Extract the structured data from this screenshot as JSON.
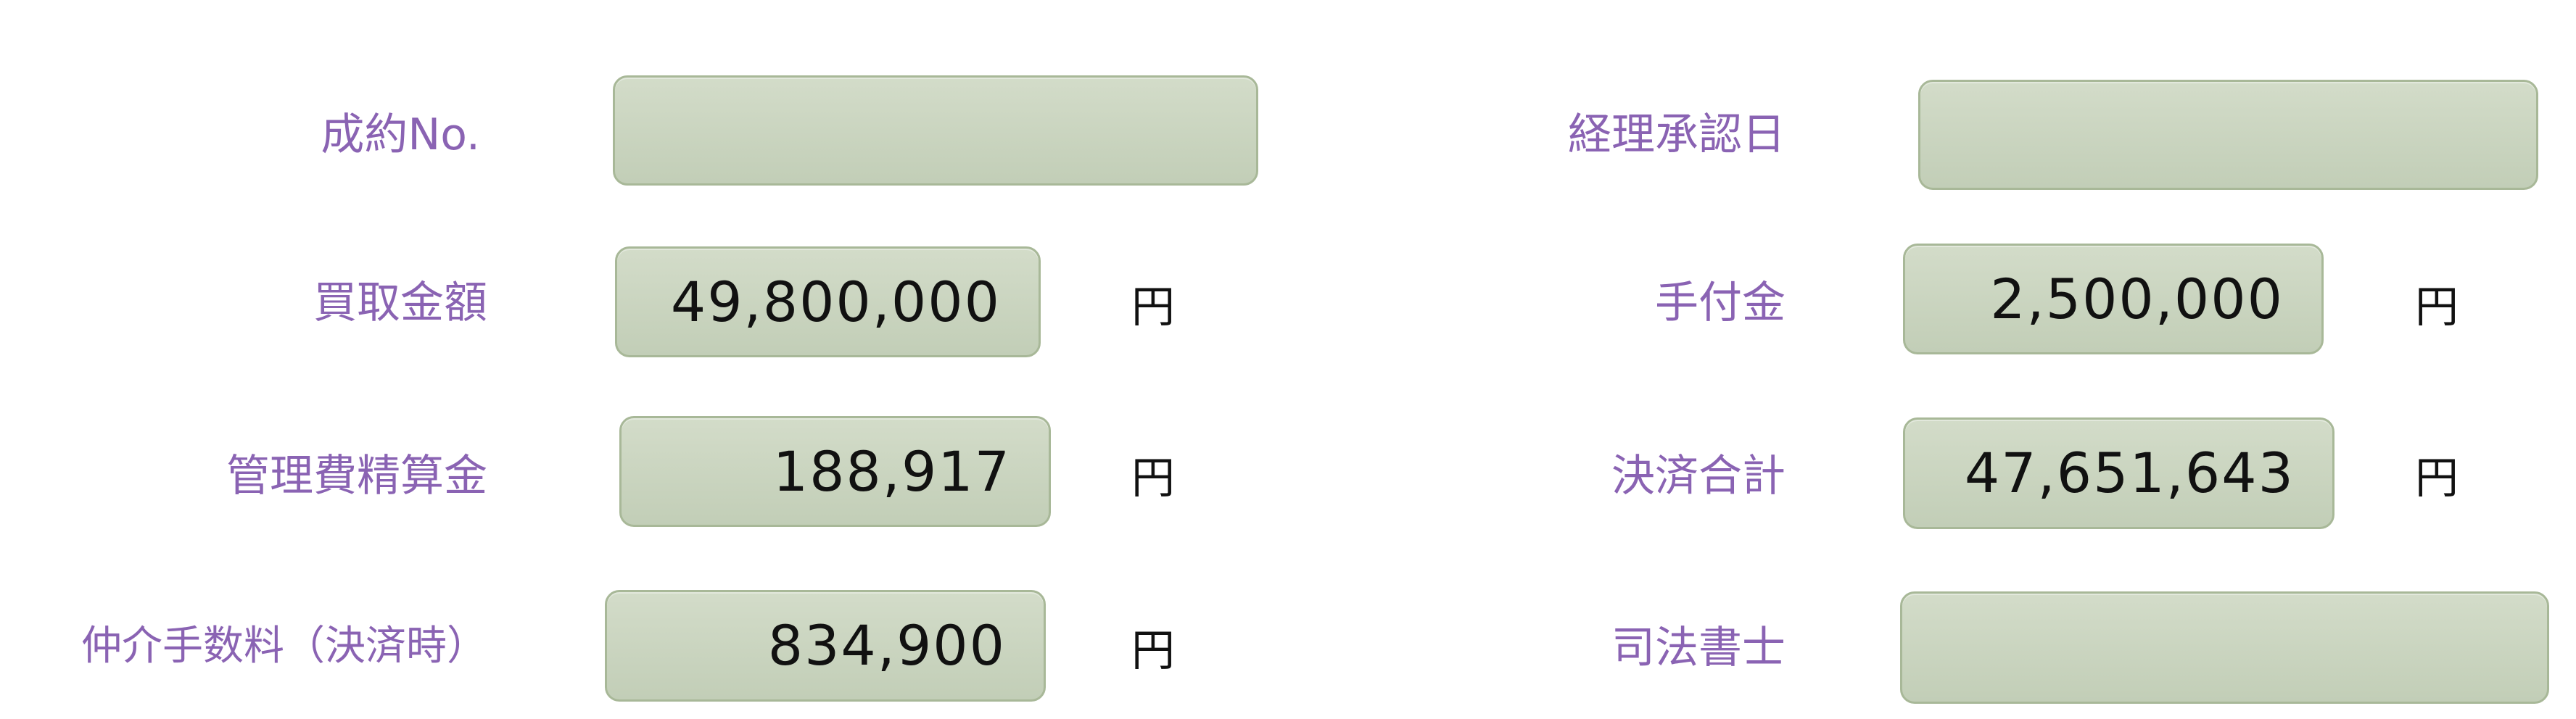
{
  "left": {
    "contract_no": {
      "label": "成約No.",
      "value": ""
    },
    "purchase_amount": {
      "label": "買取金額",
      "value": "49,800,000",
      "unit": "円"
    },
    "management_fee": {
      "label": "管理費精算金",
      "value": "188,917",
      "unit": "円"
    },
    "brokerage_fee": {
      "label": "仲介手数料（決済時）",
      "value": "834,900",
      "unit": "円"
    }
  },
  "right": {
    "accounting_approval_date": {
      "label": "経理承認日",
      "value": ""
    },
    "deposit": {
      "label": "手付金",
      "value": "2,500,000",
      "unit": "円"
    },
    "settlement_total": {
      "label": "決済合計",
      "value": "47,651,643",
      "unit": "円"
    },
    "judicial_scrivener": {
      "label": "司法書士",
      "value": ""
    }
  }
}
